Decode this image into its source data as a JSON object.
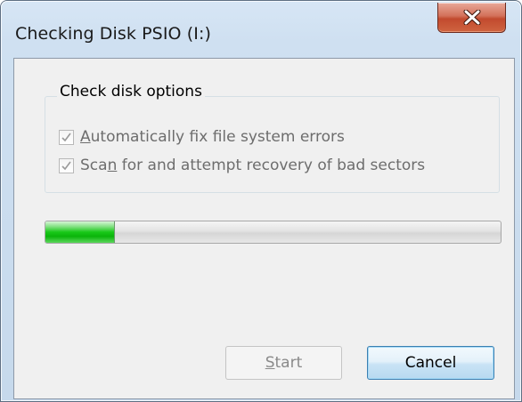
{
  "window": {
    "title": "Checking Disk PSIO (I:)"
  },
  "group": {
    "label": "Check disk options"
  },
  "options": [
    {
      "mnemonic": "A",
      "rest": "utomatically fix file system errors",
      "checked": true,
      "enabled": false
    },
    {
      "pre": "Sca",
      "mnemonic": "n",
      "rest": " for and attempt recovery of bad sectors",
      "checked": true,
      "enabled": false
    }
  ],
  "progress": {
    "value_percent": 15
  },
  "buttons": {
    "start_mnemonic": "S",
    "start_rest": "tart",
    "start_enabled": false,
    "cancel_label": "Cancel"
  },
  "icons": {
    "close": "close-icon",
    "check": "checkmark-icon"
  },
  "colors": {
    "progress_fill": "#18c818",
    "close_button": "#c24a2e",
    "default_button_border": "#3c7fb1"
  }
}
